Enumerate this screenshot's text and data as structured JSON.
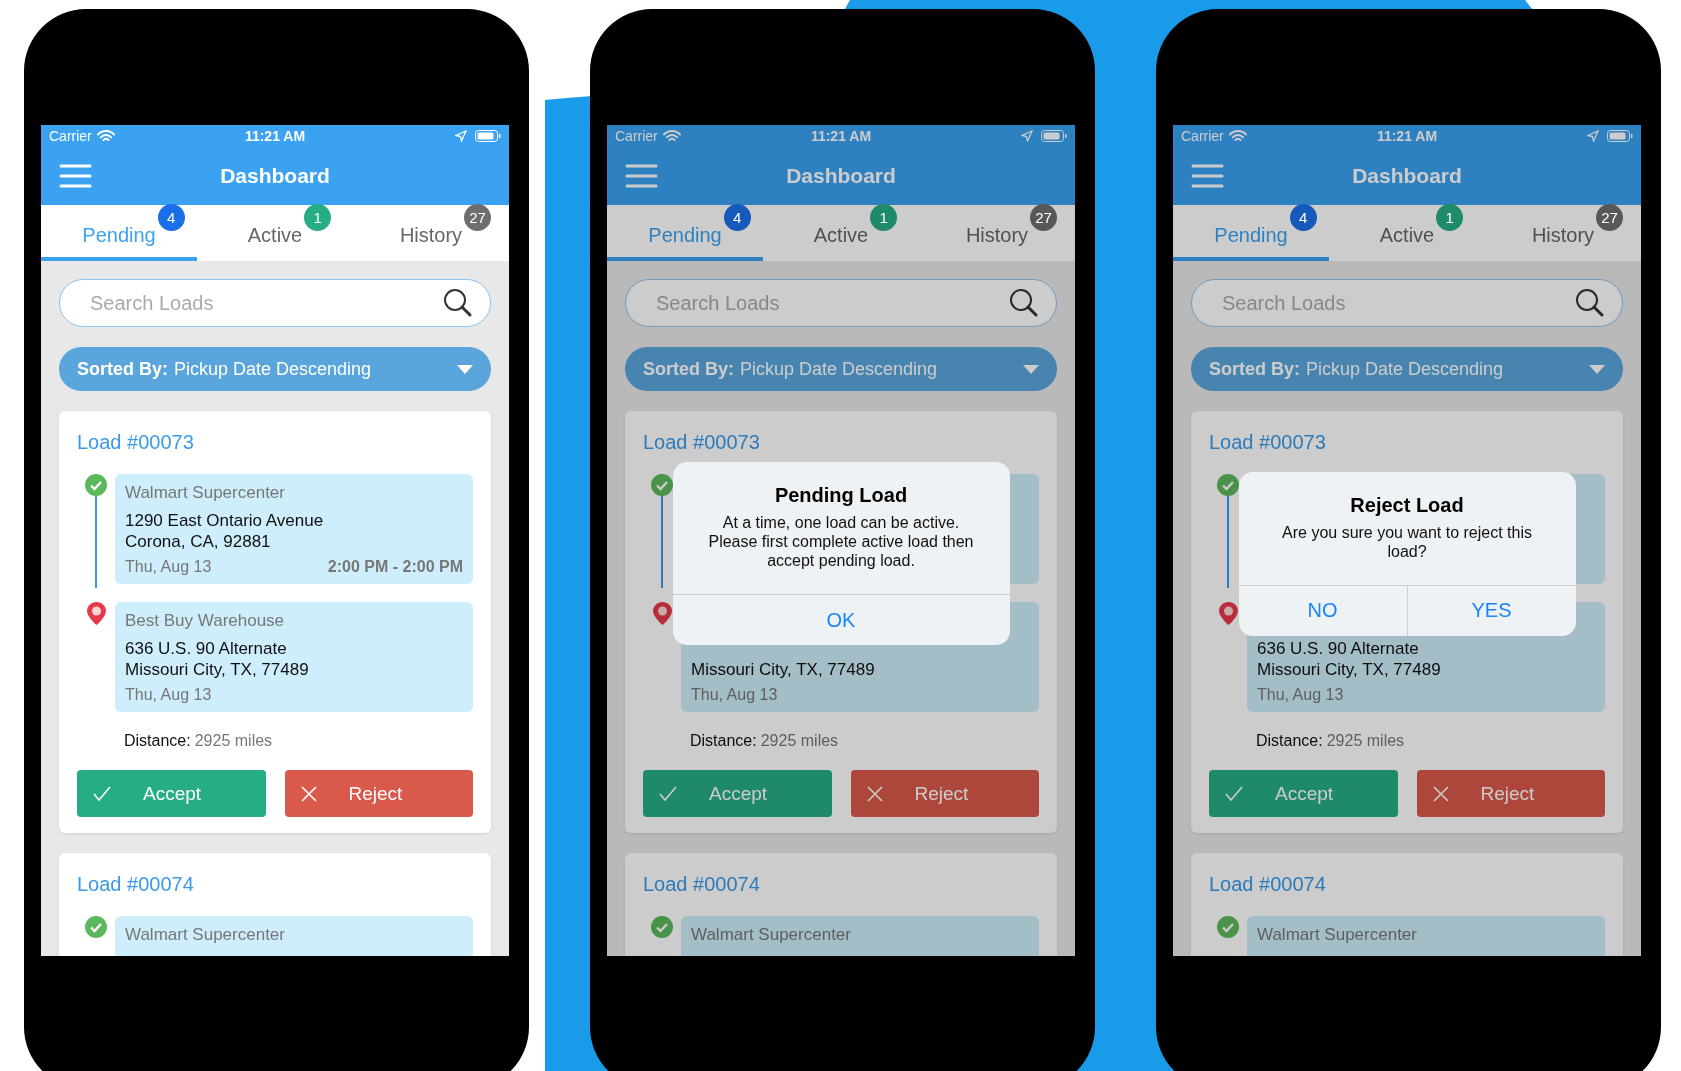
{
  "phones": [
    {
      "status_bar": {
        "carrier": "Carrier",
        "time": "11:21 AM"
      },
      "title": "Dashboard",
      "tabs": [
        {
          "label": "Pending",
          "count": "4",
          "color": "#1a6fe8",
          "selected": true
        },
        {
          "label": "Active",
          "count": "1",
          "color": "#27ad86",
          "selected": false
        },
        {
          "label": "History",
          "count": "27",
          "color": "#6e6e6e",
          "selected": false
        }
      ],
      "search": {
        "placeholder": "Search Loads"
      },
      "sort": {
        "label": "Sorted By:",
        "value": "Pickup Date Descending"
      },
      "loads": [
        {
          "title": "Load #00073",
          "stops": [
            {
              "kind": "pickup",
              "name": "Walmart Supercenter",
              "address": "1290 East Ontario Avenue",
              "city": "Corona, CA, 92881",
              "date": "Thu, Aug 13",
              "time": "2:00 PM - 2:00 PM"
            },
            {
              "kind": "dropoff",
              "name": "Best Buy Warehouse",
              "address": "636 U.S. 90 Alternate",
              "city": "Missouri City, TX, 77489",
              "date": "Thu, Aug 13"
            }
          ],
          "distance_label": "Distance:",
          "distance": "2925 miles",
          "actions": [
            {
              "kind": "accept",
              "label": "Accept"
            },
            {
              "kind": "reject",
              "label": "Reject"
            }
          ]
        },
        {
          "title": "Load #00074",
          "stops": [
            {
              "kind": "pickup",
              "name": "Walmart Supercenter"
            }
          ]
        }
      ]
    },
    {
      "status_bar": {
        "carrier": "Carrier",
        "time": "11:21 AM"
      },
      "title": "Dashboard",
      "tabs": [
        {
          "label": "Pending",
          "count": "4",
          "color": "#1559ba",
          "selected": true
        },
        {
          "label": "Active",
          "count": "1",
          "color": "#1f8a6b",
          "selected": false
        },
        {
          "label": "History",
          "count": "27",
          "color": "#585858",
          "selected": false
        }
      ],
      "search": {
        "placeholder": "Search Loads"
      },
      "sort": {
        "label": "Sorted By:",
        "value": "Pickup Date Descending"
      },
      "loads": [
        {
          "title": "Load #00073",
          "stops": [
            {
              "kind": "pickup"
            },
            {
              "kind": "dropoff",
              "city": "Missouri City, TX, 77489",
              "date": "Thu, Aug 13"
            }
          ],
          "distance_label": "Distance:",
          "distance": "2925 miles",
          "actions": [
            {
              "kind": "accept",
              "label": "Accept"
            },
            {
              "kind": "reject",
              "label": "Reject"
            }
          ]
        },
        {
          "title": "Load #00074",
          "stops": [
            {
              "kind": "pickup",
              "name": "Walmart Supercenter"
            }
          ]
        }
      ],
      "dialog": {
        "title": "Pending Load",
        "message": "At a time, one load can be active. Please first complete active load then accept pending load.",
        "buttons": [
          "OK"
        ]
      }
    },
    {
      "status_bar": {
        "carrier": "Carrier",
        "time": "11:21 AM"
      },
      "title": "Dashboard",
      "tabs": [
        {
          "label": "Pending",
          "count": "4",
          "color": "#1559ba",
          "selected": true
        },
        {
          "label": "Active",
          "count": "1",
          "color": "#1f8a6b",
          "selected": false
        },
        {
          "label": "History",
          "count": "27",
          "color": "#585858",
          "selected": false
        }
      ],
      "search": {
        "placeholder": "Search Loads"
      },
      "sort": {
        "label": "Sorted By:",
        "value": "Pickup Date Descending"
      },
      "loads": [
        {
          "title": "Load #00073",
          "stops": [
            {
              "kind": "pickup"
            },
            {
              "kind": "dropoff",
              "address": "636 U.S. 90 Alternate",
              "city": "Missouri City, TX, 77489",
              "date": "Thu, Aug 13"
            }
          ],
          "distance_label": "Distance:",
          "distance": "2925 miles",
          "actions": [
            {
              "kind": "accept",
              "label": "Accept"
            },
            {
              "kind": "reject",
              "label": "Reject"
            }
          ]
        },
        {
          "title": "Load #00074",
          "stops": [
            {
              "kind": "pickup",
              "name": "Walmart Supercenter"
            }
          ]
        }
      ],
      "dialog": {
        "title": "Reject Load",
        "message": "Are you sure you want to reject this load?",
        "buttons": [
          "NO",
          "YES"
        ]
      }
    }
  ]
}
